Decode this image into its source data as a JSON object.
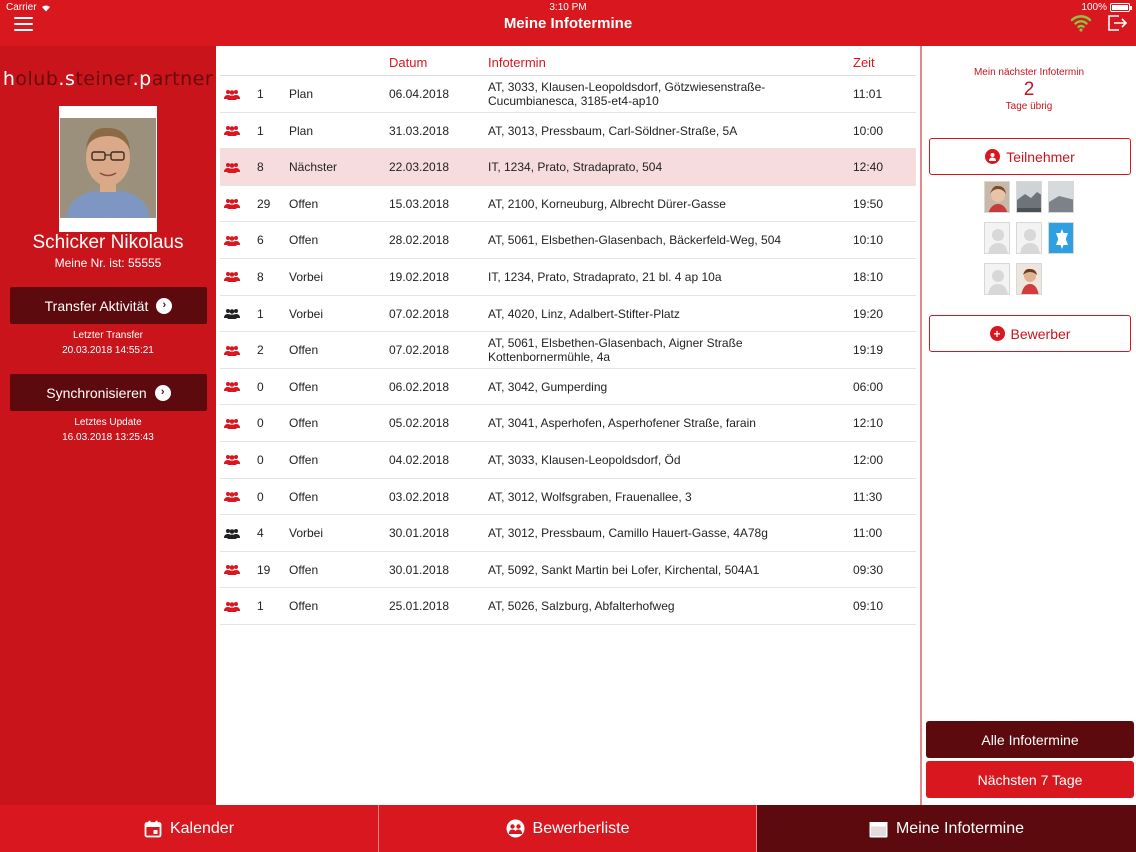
{
  "status_bar": {
    "carrier": "Carrier",
    "time": "3:10 PM",
    "battery": "100%"
  },
  "header": {
    "title": "Meine Infotermine"
  },
  "logo": {
    "part1": "h",
    "part2": "olub",
    "part3": ".s",
    "part4": "teiner",
    "part5": ".p",
    "part6": "artner"
  },
  "profile": {
    "name": "Schicker Nikolaus",
    "number": "Meine Nr. ist: 55555",
    "transfer_label": "Transfer Aktivität",
    "transfer_note_label": "Letzter Transfer",
    "transfer_note_value": "20.03.2018 14:55:21",
    "sync_label": "Synchronisieren",
    "sync_note_label": "Letztes Update",
    "sync_note_value": "16.03.2018 13:25:43"
  },
  "table": {
    "headers": {
      "datum": "Datum",
      "infotermin": "Infotermin",
      "zeit": "Zeit"
    },
    "rows": [
      {
        "icon": "group-icon",
        "icon_color": "#d9171e",
        "count": "1",
        "status": "Plan",
        "datum": "06.04.2018",
        "info": "AT, 3033, Klausen-Leopoldsdorf, Götzwiesenstraße-Cucumbianesca, 3185-et4-ap10",
        "zeit": "11:01"
      },
      {
        "icon": "group-icon",
        "icon_color": "#d9171e",
        "count": "1",
        "status": "Plan",
        "datum": "31.03.2018",
        "info": "AT, 3013, Pressbaum, Carl-Söldner-Straße, 5A",
        "zeit": "10:00"
      },
      {
        "icon": "group-icon",
        "icon_color": "#d9171e",
        "count": "8",
        "status": "Nächster",
        "datum": "22.03.2018",
        "info": "IT, 1234, Prato, Stradaprato, 504",
        "zeit": "12:40"
      },
      {
        "icon": "group-icon",
        "icon_color": "#d9171e",
        "count": "29",
        "status": "Offen",
        "datum": "15.03.2018",
        "info": "AT, 2100, Korneuburg, Albrecht Dürer-Gasse",
        "zeit": "19:50"
      },
      {
        "icon": "group-icon",
        "icon_color": "#d9171e",
        "count": "6",
        "status": "Offen",
        "datum": "28.02.2018",
        "info": "AT, 5061, Elsbethen-Glasenbach, Bäckerfeld-Weg, 504",
        "zeit": "10:10"
      },
      {
        "icon": "group-icon",
        "icon_color": "#d9171e",
        "count": "8",
        "status": "Vorbei",
        "datum": "19.02.2018",
        "info": "IT, 1234, Prato, Stradaprato, 21 bl. 4 ap 10a",
        "zeit": "18:10"
      },
      {
        "icon": "group-icon",
        "icon_color": "#222222",
        "count": "1",
        "status": "Vorbei",
        "datum": "07.02.2018",
        "info": "AT, 4020, Linz, Adalbert-Stifter-Platz",
        "zeit": "19:20"
      },
      {
        "icon": "group-icon",
        "icon_color": "#d9171e",
        "count": "2",
        "status": "Offen",
        "datum": "07.02.2018",
        "info": "AT, 5061, Elsbethen-Glasenbach, Aigner Straße Kottenbornermühle, 4a",
        "zeit": "19:19"
      },
      {
        "icon": "group-icon",
        "icon_color": "#d9171e",
        "count": "0",
        "status": "Offen",
        "datum": "06.02.2018",
        "info": "AT, 3042, Gumperding",
        "zeit": "06:00"
      },
      {
        "icon": "group-icon",
        "icon_color": "#d9171e",
        "count": "0",
        "status": "Offen",
        "datum": "05.02.2018",
        "info": "AT, 3041, Asperhofen, Asperhofener Straße, farain",
        "zeit": "12:10"
      },
      {
        "icon": "group-icon",
        "icon_color": "#d9171e",
        "count": "0",
        "status": "Offen",
        "datum": "04.02.2018",
        "info": "AT, 3033, Klausen-Leopoldsdorf, Öd",
        "zeit": "12:00"
      },
      {
        "icon": "group-icon",
        "icon_color": "#d9171e",
        "count": "0",
        "status": "Offen",
        "datum": "03.02.2018",
        "info": "AT, 3012, Wolfsgraben, Frauenallee, 3",
        "zeit": "11:30"
      },
      {
        "icon": "group-icon",
        "icon_color": "#222222",
        "count": "4",
        "status": "Vorbei",
        "datum": "30.01.2018",
        "info": "AT, 3012, Pressbaum, Camillo Hauert-Gasse, 4A78g",
        "zeit": "11:00"
      },
      {
        "icon": "group-icon",
        "icon_color": "#d9171e",
        "count": "19",
        "status": "Offen",
        "datum": "30.01.2018",
        "info": "AT, 5092, Sankt Martin bei Lofer, Kirchental, 504A1",
        "zeit": "09:30"
      },
      {
        "icon": "group-icon",
        "icon_color": "#d9171e",
        "count": "1",
        "status": "Offen",
        "datum": "25.01.2018",
        "info": "AT, 5026, Salzburg, Abfalterhofweg",
        "zeit": "09:10"
      }
    ]
  },
  "right_panel": {
    "next_label": "Mein nächster Infotermin",
    "next_days": "2",
    "next_sub": "Tage übrig",
    "teilnehmer_label": "Teilnehmer",
    "bewerber_label": "Bewerber",
    "thumbnails": [
      "avatar-photo",
      "avatar-landscape",
      "avatar-landscape",
      "avatar-placeholder",
      "avatar-placeholder",
      "avatar-star",
      "avatar-placeholder",
      "avatar-photo"
    ],
    "alle_label": "Alle Infotermine",
    "naechsten_label": "Nächsten 7 Tage"
  },
  "tabs": [
    {
      "label": "Kalender",
      "icon": "calendar-icon"
    },
    {
      "label": "Bewerberliste",
      "icon": "group-circle-icon"
    },
    {
      "label": "Meine Infotermine",
      "icon": "calendar-full-icon",
      "active": true
    }
  ],
  "colors": {
    "primary": "#d9171e",
    "dark": "#5c0a0d",
    "highlight": "#f7dcdd"
  }
}
